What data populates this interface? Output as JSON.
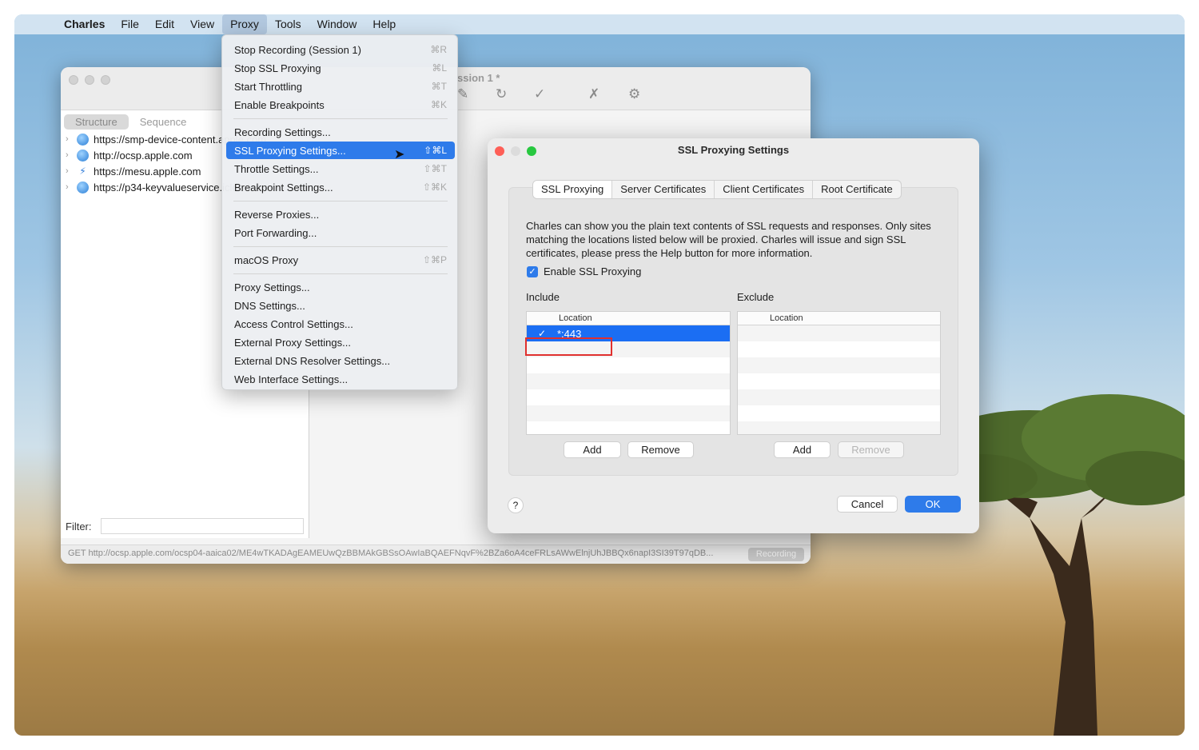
{
  "menubar": {
    "apple": "",
    "app": "Charles",
    "items": [
      "File",
      "Edit",
      "View",
      "Proxy",
      "Tools",
      "Window",
      "Help"
    ]
  },
  "proxy_menu": {
    "groups": [
      [
        {
          "label": "Stop Recording (Session 1)",
          "shortcut": "⌘R"
        },
        {
          "label": "Stop SSL Proxying",
          "shortcut": "⌘L"
        },
        {
          "label": "Start Throttling",
          "shortcut": "⌘T"
        },
        {
          "label": "Enable Breakpoints",
          "shortcut": "⌘K"
        }
      ],
      [
        {
          "label": "Recording Settings...",
          "shortcut": ""
        },
        {
          "label": "SSL Proxying Settings...",
          "shortcut": "⇧⌘L",
          "highlighted": true
        },
        {
          "label": "Throttle Settings...",
          "shortcut": "⇧⌘T"
        },
        {
          "label": "Breakpoint Settings...",
          "shortcut": "⇧⌘K"
        }
      ],
      [
        {
          "label": "Reverse Proxies...",
          "shortcut": ""
        },
        {
          "label": "Port Forwarding...",
          "shortcut": ""
        }
      ],
      [
        {
          "label": "macOS Proxy",
          "shortcut": "⇧⌘P"
        }
      ],
      [
        {
          "label": "Proxy Settings...",
          "shortcut": ""
        },
        {
          "label": "DNS Settings...",
          "shortcut": ""
        },
        {
          "label": "Access Control Settings...",
          "shortcut": ""
        },
        {
          "label": "External Proxy Settings...",
          "shortcut": ""
        },
        {
          "label": "External DNS Resolver Settings...",
          "shortcut": ""
        },
        {
          "label": "Web Interface Settings...",
          "shortcut": ""
        }
      ]
    ]
  },
  "main_window": {
    "title_fragment": "ssion 1 *",
    "tabs": {
      "structure": "Structure",
      "sequence": "Sequence"
    },
    "tree": [
      {
        "label": "https://smp-device-content.apple.com",
        "icon": "globe-icon"
      },
      {
        "label": "http://ocsp.apple.com",
        "icon": "globe-icon"
      },
      {
        "label": "https://mesu.apple.com",
        "icon": "bolt-icon"
      },
      {
        "label": "https://p34-keyvalueservice.icloud.com",
        "icon": "globe-icon"
      }
    ],
    "filter_label": "Filter:",
    "status": "GET http://ocsp.apple.com/ocsp04-aaica02/ME4wTKADAgEAMEUwQzBBMAkGBSsOAwIaBQAEFNqvF%2BZa6oA4ceFRLsAWwElnjUhJBBQx6napI3SI39T97qDB...",
    "recording": "Recording"
  },
  "dialog": {
    "title": "SSL Proxying Settings",
    "tabs": [
      "SSL Proxying",
      "Server Certificates",
      "Client Certificates",
      "Root Certificate"
    ],
    "description": "Charles can show you the plain text contents of SSL requests and responses. Only sites matching the locations listed below will be proxied. Charles will issue and sign SSL certificates, please press the Help button for more information.",
    "enable_label": "Enable SSL Proxying",
    "include_label": "Include",
    "exclude_label": "Exclude",
    "location_header": "Location",
    "include_rows": [
      "*:443"
    ],
    "add": "Add",
    "remove": "Remove",
    "help": "?",
    "cancel": "Cancel",
    "ok": "OK"
  },
  "colors": {
    "accent": "#2e7bea",
    "highlight_box": "#e0302e"
  }
}
